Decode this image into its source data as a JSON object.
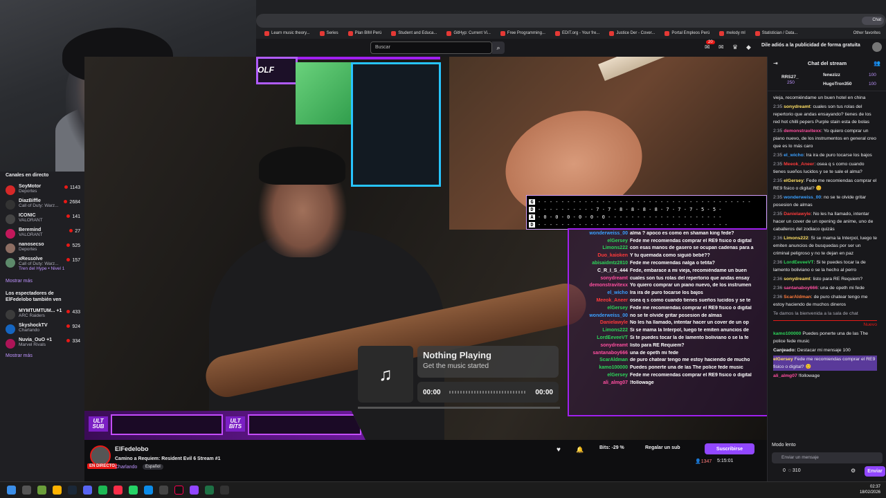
{
  "browser": {
    "bookmarks": [
      "Learn music theory...",
      "Series",
      "Plan BIM Perú",
      "Student and Educa...",
      "GitHyp: Current Vi...",
      "Free Programming...",
      "EDIT.org - Your fre...",
      "Justice Der - Cover...",
      "Portal Empleos Perú",
      "melody ml",
      "Statistician / Data..."
    ],
    "other_favorites": "Other favorites",
    "chat_ext": "Chat"
  },
  "twitch_top": {
    "search_placeholder": "Buscar",
    "notif_count": "20",
    "ads_banner": "Dile adiós a la publicidad de forma gratuita"
  },
  "sidebar": {
    "live_header": "Canales en directo",
    "channels": [
      {
        "name": "SoyMotor",
        "game": "Deportes",
        "viewers": "1143"
      },
      {
        "name": "DiazBiffle",
        "game": "Call of Duty: Warz...",
        "viewers": "2684"
      },
      {
        "name": "ICONIC",
        "game": "VALORANT",
        "viewers": "141"
      },
      {
        "name": "Beremind",
        "game": "VALORANT",
        "viewers": "27"
      },
      {
        "name": "nanosecso",
        "game": "Deportes",
        "viewers": "525"
      },
      {
        "name": "xRessolve",
        "game": "Call of Duty: Warz...",
        "viewers": "157",
        "extra": "Tren del Hype • Nivel 1"
      }
    ],
    "show_more": "Mostrar más",
    "viewers_header": "Los espectadores de ElFedelobo también ven",
    "also_watch": [
      {
        "name": "MYMTUMTUM... +1",
        "game": "ARC Raiders",
        "viewers": "433"
      },
      {
        "name": "SkyshockTV",
        "game": "Charlando",
        "viewers": "924"
      },
      {
        "name": "Nuvia_OuO +1",
        "game": "Marvel Rivals",
        "viewers": "334"
      }
    ],
    "show_more_2": "Mostrar más"
  },
  "overlay": {
    "wolf": "OLF",
    "tab": [
      {
        "string": "G",
        "notes": "- - - - - - - - - - - - - - - - - - - - - - - - - - - - - - - - - - - - -"
      },
      {
        "string": "D",
        "notes": "- - - - - - - - - - 7 - 7 - 8 - 8 - 8 - 8 - 7 - 7 - 7 - 5 - 5 -"
      },
      {
        "string": "A",
        "notes": "- 0 - 0 - 0 - 0 - 0 - 0 - - - - - - - - - - - - - - - - - - - -"
      },
      {
        "string": "D",
        "notes": "- - - - - - - - - - - - - - - - - - - - - - - - - - - - - - - - -"
      }
    ],
    "chat": [
      {
        "user": "wonderweiss_00",
        "color": "#3aa0ff",
        "msg": "alma ? apoco es como en shaman king fede?"
      },
      {
        "user": "elGersey",
        "color": "#2dd65a",
        "msg": "Fede me recomiendas comprar el RE9 fisico o digital"
      },
      {
        "user": "Limons222",
        "color": "#2dd65a",
        "msg": "con esas manos de gasero se ocupan cadenas para a"
      },
      {
        "user": "Duo_kaioken",
        "color": "#ff3b3b",
        "msg": "Y tu quemada como siguió bebé??"
      },
      {
        "user": "abisaidmtz2810",
        "color": "#2dd65a",
        "msg": "Fede me recomiendas nalga o tetita?"
      },
      {
        "user": "C_R_I_S_444",
        "color": "#ffffff",
        "msg": "Fede, embarace a mi vieja, recomiéndame un buen"
      },
      {
        "user": "sonydreamt",
        "color": "#ff4fa0",
        "msg": "cuales son tus rolas del repertorio que andas ensay"
      },
      {
        "user": "demonstravitexx",
        "color": "#ff4fa0",
        "msg": "Yo quiero comprar un piano nuevo, de los instrumen"
      },
      {
        "user": "el_wicho",
        "color": "#3aa0ff",
        "msg": "Ira ira de puro tocarse los bajos"
      },
      {
        "user": "Meeok_Aneer",
        "color": "#ff3b3b",
        "msg": "osea q s como cuando tienes sueños lucidos y se te"
      },
      {
        "user": "elGersey",
        "color": "#2dd65a",
        "msg": "Fede me recomiendas comprar el RE9 fisico o digital"
      },
      {
        "user": "wonderweiss_00",
        "color": "#3aa0ff",
        "msg": "no se te olvide gritar posesion de almas"
      },
      {
        "user": "Danielawyle",
        "color": "#ff3b3b",
        "msg": "No les ha llamado, intentar hacer un cover de un op"
      },
      {
        "user": "Limons222",
        "color": "#2dd65a",
        "msg": "Si se mama la Interpol, luego te emiten anuncios de"
      },
      {
        "user": "LordEeveeVT",
        "color": "#2dd65a",
        "msg": "Si te puedes tocar la de lamento boliviano o se la fe"
      },
      {
        "user": "sonydreamt",
        "color": "#ff4fa0",
        "msg": "listo para RE Requiem?"
      },
      {
        "user": "santanaboy666",
        "color": "#ff4fa0",
        "msg": "una de opeth mi fede"
      },
      {
        "user": "ScarAldman",
        "color": "#2dd65a",
        "msg": "de puro chatear tengo me estoy haciendo de mucho"
      },
      {
        "user": "kamo100000",
        "color": "#2dd65a",
        "msg": "Puedes ponerte una de las The police fede music"
      },
      {
        "user": "elGersey",
        "color": "#2dd65a",
        "msg": "Fede me recomiendas comprar el RE9 fisico o digital"
      },
      {
        "user": "ali_almg07",
        "color": "#ff4fa0",
        "msg": "!followage"
      }
    ],
    "ult_sub": "ULT SUB",
    "ult_bits": "ULT BITS"
  },
  "music": {
    "title": "Nothing Playing",
    "subtitle": "Get the music started",
    "time_start": "00:00",
    "time_end": "00:00"
  },
  "stream_info": {
    "streamer": "ElFedelobo",
    "title": "Camino a Requiem: Resident Evil 6 Stream #1",
    "category": "Charlando",
    "language": "Español",
    "live": "EN DIRECTO",
    "bits": "Bits: -29 %",
    "gift": "Regalar un sub",
    "subscribe": "Suscribirse",
    "viewers": "1347",
    "uptime": "5:15:01"
  },
  "chat": {
    "title": "Chat del stream",
    "leaders": [
      {
        "name": "RRS27_",
        "amount": "250"
      },
      {
        "name": "fenezizz",
        "amount": "100"
      },
      {
        "name": "HugoTron350",
        "amount": "100"
      }
    ],
    "messages": [
      {
        "time": "",
        "user": "",
        "color": "#efeff1",
        "text": "vieja, recomiéndame un buen hotel en china"
      },
      {
        "time": "2:35",
        "user": "sonydreamt",
        "color": "#ffe066",
        "text": "cuales son tus rolas del repertorio que andas ensayando? tienes de los red hot chilli pepers Purple stain esta de bolas"
      },
      {
        "time": "2:35",
        "user": "demonstravitexx",
        "color": "#ff4fa0",
        "text": "Yo quiero comprar un piano nuevo, de los instrumentos en general creo que es lo más caro"
      },
      {
        "time": "2:35",
        "user": "el_wicho",
        "color": "#3aa0ff",
        "text": "Ira ira de puro tocarse los bajos"
      },
      {
        "time": "2:35",
        "user": "Meeok_Aneer",
        "color": "#ff3b3b",
        "text": "osea q s como cuando tienes sueños lucidos y se te sale el alma?"
      },
      {
        "time": "2:35",
        "user": "elGersey",
        "color": "#ffe066",
        "text": "Fede me recomiendas comprar el RE9 fisico o digital? 😊"
      },
      {
        "time": "2:35",
        "user": "wonderweiss_00",
        "color": "#3aa0ff",
        "text": "no se te olvide gritar posesion de almas"
      },
      {
        "time": "2:35",
        "user": "Danielawyle",
        "color": "#ff3b3b",
        "text": "No les ha llamado, intentar hacer un cover de un opening de anime, uno de caballeros del zodiaco quizás"
      },
      {
        "time": "2:36",
        "user": "Limons222",
        "color": "#ffe066",
        "text": "Si se mama la Interpol, luego te emiten anuncios de busquedas por ser un criminal peligroso y no te dejan en paz"
      },
      {
        "time": "2:36",
        "user": "LordEeveeVT",
        "color": "#2dd65a",
        "text": "Si te puedes tocar la de lamento boliviano o se la hecho al perro"
      },
      {
        "time": "2:36",
        "user": "sonydreamt",
        "color": "#ffe066",
        "text": "listo para RE Requiem?"
      },
      {
        "time": "2:36",
        "user": "santanaboy666",
        "color": "#ff4fa0",
        "text": "una de opeth mi fede"
      },
      {
        "time": "2:36",
        "user": "ScarAldman",
        "color": "#ff7b3b",
        "text": "de puro chatear tengo me estoy haciendo de muchos dineros"
      }
    ],
    "welcome": "Te damos la bienvenida a la sala de chat",
    "new_label": "Nuevo",
    "after": [
      {
        "user": "kamo100000",
        "color": "#2dd65a",
        "text": "Puedes ponerte una de las The police fede music"
      },
      {
        "user": "Canjeado:",
        "color": "#efeff1",
        "text": "Destacar mi mensaje  100"
      },
      {
        "user": "elGersey",
        "color": "#ffe066",
        "text": "Fede me recomiendas comprar el RE9 fisico o digital? 😊"
      },
      {
        "user": "ali_almg07",
        "color": "#ff4fa0",
        "text": "!followage"
      }
    ],
    "slow_mode": "Modo lento",
    "input_placeholder": "Enviar un mensaje",
    "points": "0",
    "channel_points": "310",
    "send": "Enviar"
  },
  "taskbar": {
    "time": "02:37",
    "date": "18/02/2026"
  }
}
